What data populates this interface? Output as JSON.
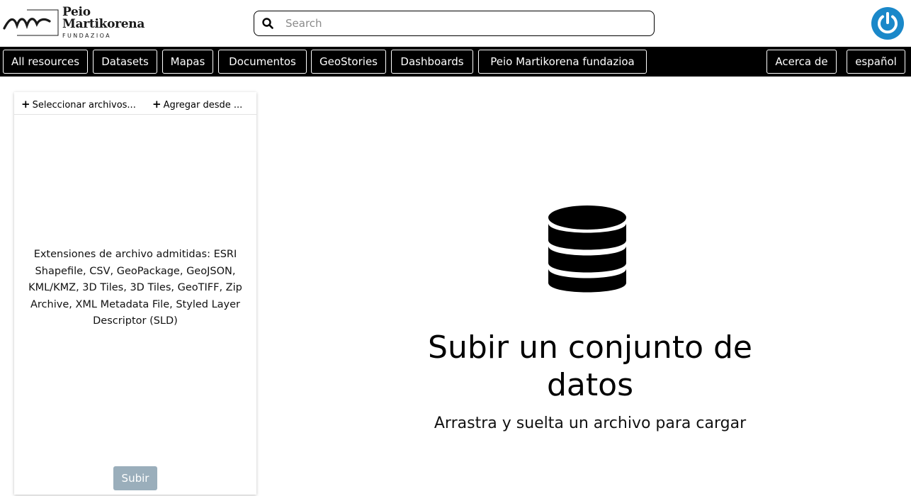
{
  "header": {
    "logo": {
      "line1": "Peio",
      "line2": "Martikorena",
      "sub": "FUNDAZIOA"
    },
    "search": {
      "placeholder": "Search",
      "value": ""
    },
    "power_icon": "power-icon",
    "accent_color": "#1a88c9"
  },
  "nav": {
    "items": [
      {
        "label": "All resources"
      },
      {
        "label": "Datasets"
      },
      {
        "label": "Mapas"
      },
      {
        "label": "Documentos"
      },
      {
        "label": "GeoStories"
      },
      {
        "label": "Dashboards"
      },
      {
        "label": "Peio Martikorena fundazioa"
      }
    ],
    "right": [
      {
        "label": "Acerca de"
      },
      {
        "label": "español"
      }
    ]
  },
  "panel": {
    "tabs": [
      {
        "label": "Seleccionar archivos..."
      },
      {
        "label": "Agregar desde ..."
      }
    ],
    "extensions_text": "Extensiones de archivo admitidas: ESRI Shapefile, CSV, GeoPackage, GeoJSON, KML/KMZ, 3D Tiles, 3D Tiles, GeoTIFF, Zip Archive, XML Metadata File, Styled Layer Descriptor (SLD)",
    "upload_label": "Subir",
    "upload_color": "#9aaebb"
  },
  "dropzone": {
    "icon": "database-icon",
    "title": "Subir un conjunto de datos",
    "subtitle": "Arrastra y suelta un archivo para cargar"
  }
}
